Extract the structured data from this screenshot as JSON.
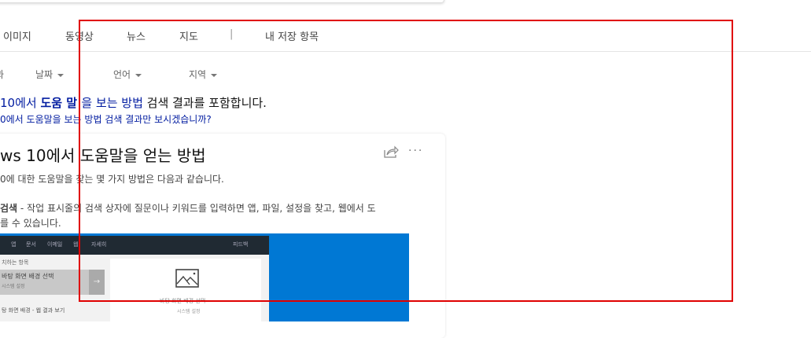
{
  "nav_tabs": [
    "이미지",
    "동영상",
    "뉴스",
    "지도",
    "|",
    "내 저장 항목"
  ],
  "filters": {
    "partial": "과",
    "items": [
      "날짜",
      "언어",
      "지역"
    ]
  },
  "spell": {
    "line1_query": "10에서 ",
    "line1_bold": "도움 말 ",
    "line1_query2": "을 보는 방법",
    "line1_rest": " 검색 결과를 포함합니다.",
    "line2": "0에서 도움말을 보는 방법 검색 결과만 보시겠습니까?"
  },
  "card": {
    "title": "ws 10에서 도움말을 얻는 방법",
    "description": "0에 대한 도움말을 찾는 몇 가지 방법은 다음과 같습니다.",
    "item_bold": "검색",
    "item_text": " - 작업 표시줄의 검색 상자에 질문이나 키워드를 입력하면 앱, 파일, 설정을 찾고, 웹에서 도",
    "item_text2": "를 수 있습니다.",
    "more": "···",
    "screenshot": {
      "bar_items": [
        "앱",
        "문서",
        "이메일",
        "웹",
        "자세히"
      ],
      "bar_right": "피드백",
      "section": "치하는 항목",
      "best_title": "바탕 화면 배경 선택",
      "best_sub": "시스템 설정",
      "row1": "탕 화면 배경 - 웹 결과 보기",
      "preview_title": "바탕 화면 배경 선택",
      "preview_sub": "시스템 설정"
    }
  },
  "colors": {
    "link": "#001ba0",
    "highlight": "#e00000",
    "windows_blue": "#0078d4"
  }
}
